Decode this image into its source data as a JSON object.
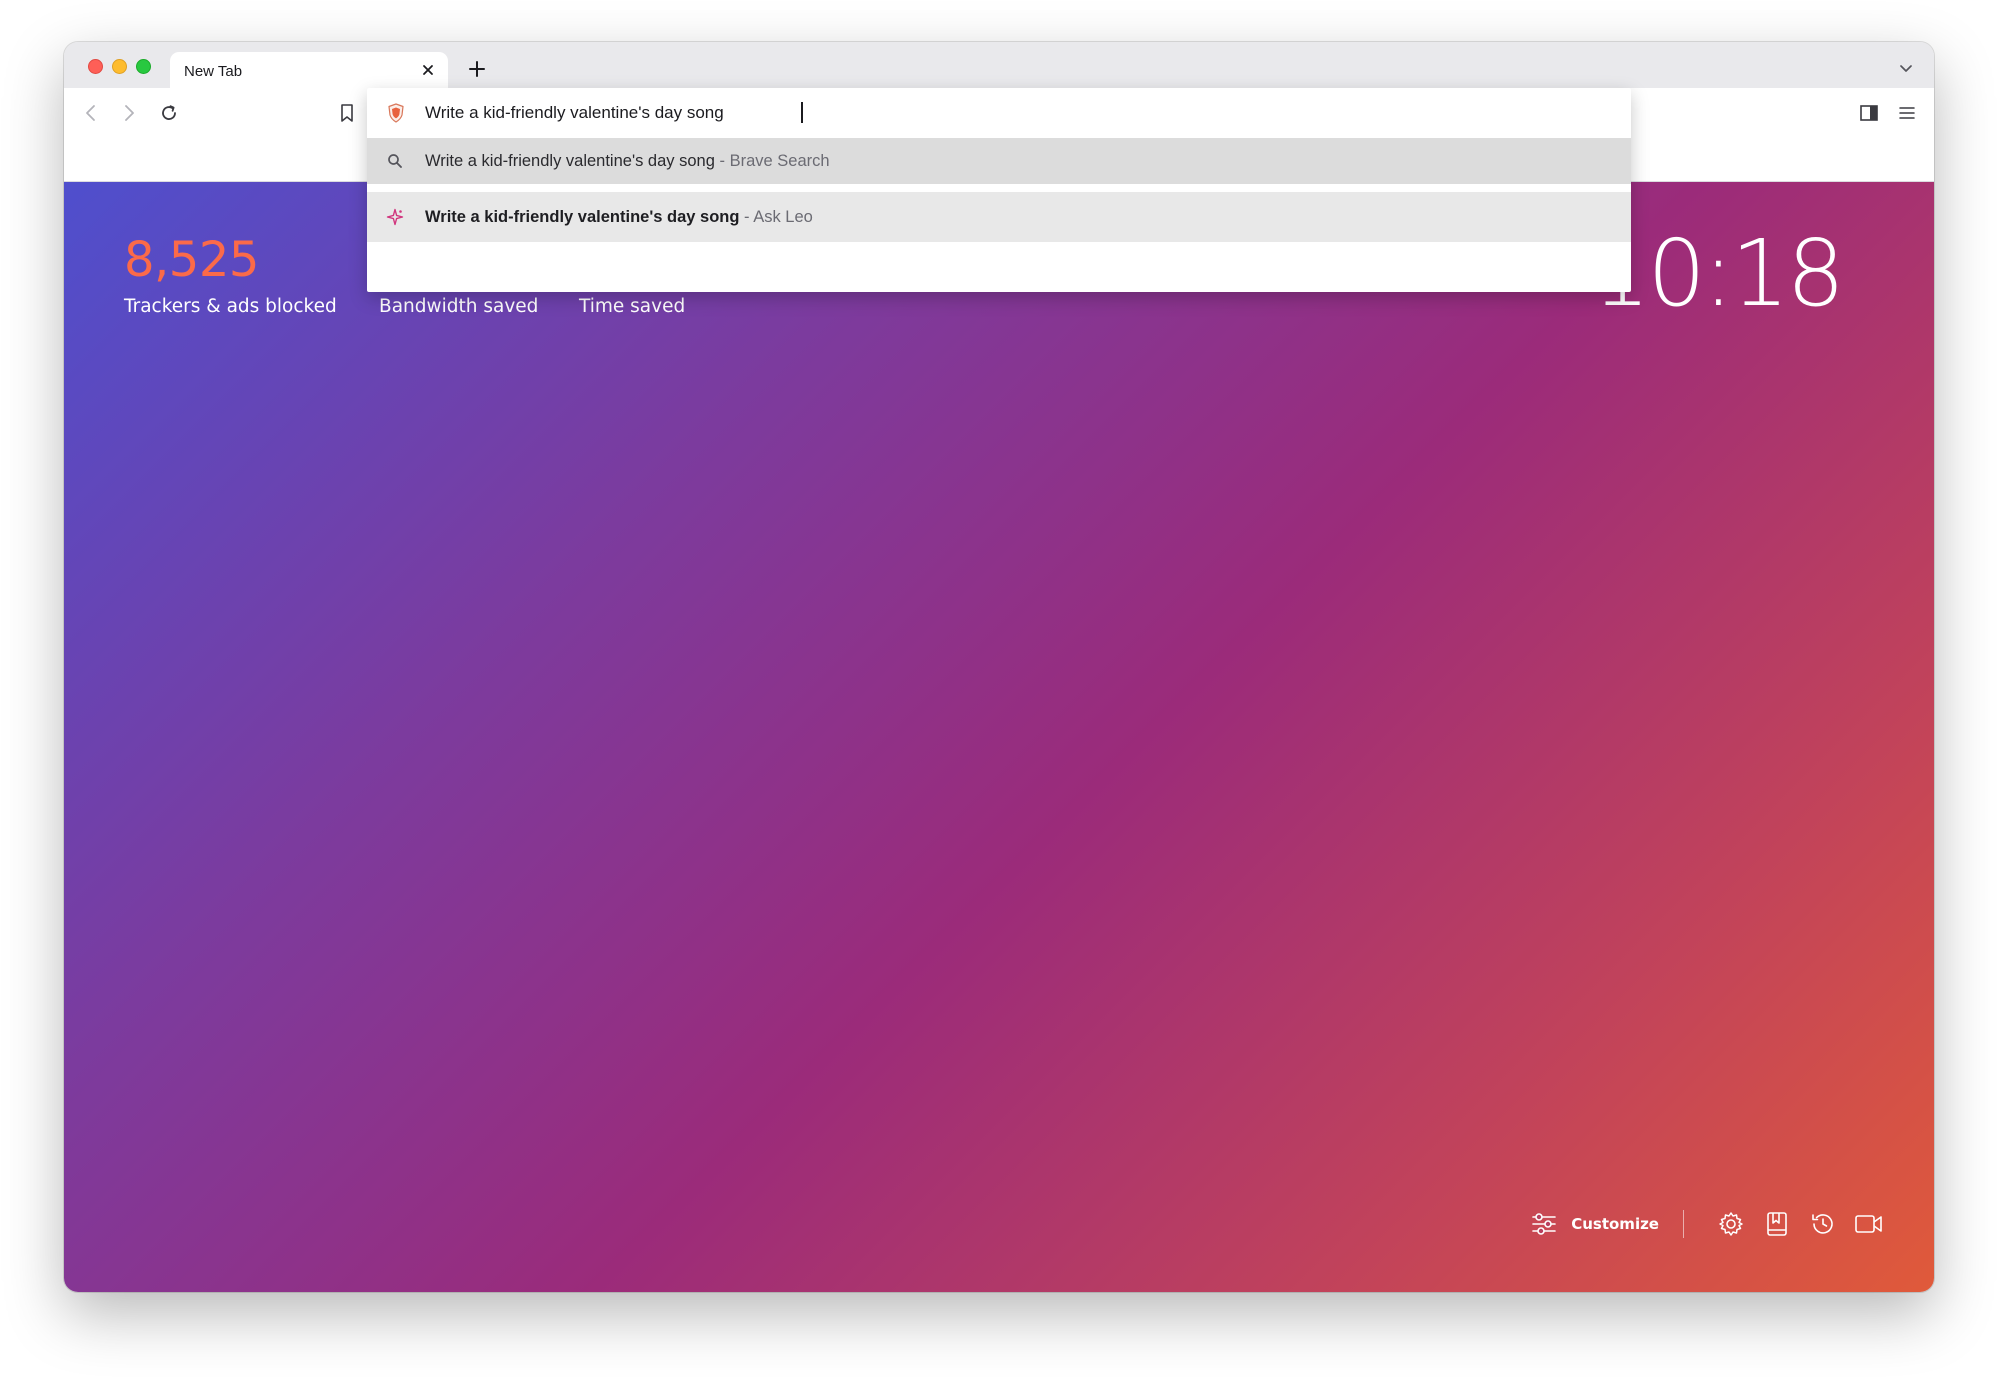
{
  "window": {
    "tab": {
      "title": "New Tab"
    }
  },
  "omnibox": {
    "value": "Write a kid-friendly valentine's day song",
    "suggestions": [
      {
        "query": "Write a kid-friendly valentine's day song",
        "separator": " - ",
        "source": "Brave Search",
        "icon": "search-icon"
      },
      {
        "query": "Write a kid-friendly valentine's day song",
        "separator": " - ",
        "source": "Ask Leo",
        "icon": "leo-sparkle-icon"
      }
    ]
  },
  "stats": {
    "trackers_value": "8,525",
    "trackers_label": "Trackers & ads blocked",
    "bandwidth_label": "Bandwidth saved",
    "time_label": "Time saved"
  },
  "clock": {
    "time": "10:18"
  },
  "bottom_bar": {
    "customize_label": "Customize",
    "icons": [
      "settings-icon",
      "bookmarks-icon",
      "history-icon",
      "video-call-icon"
    ]
  },
  "colors": {
    "stat_accent": "#fb6a49",
    "gradient_start": "#4f4fcd",
    "gradient_end": "#e05a3a"
  }
}
